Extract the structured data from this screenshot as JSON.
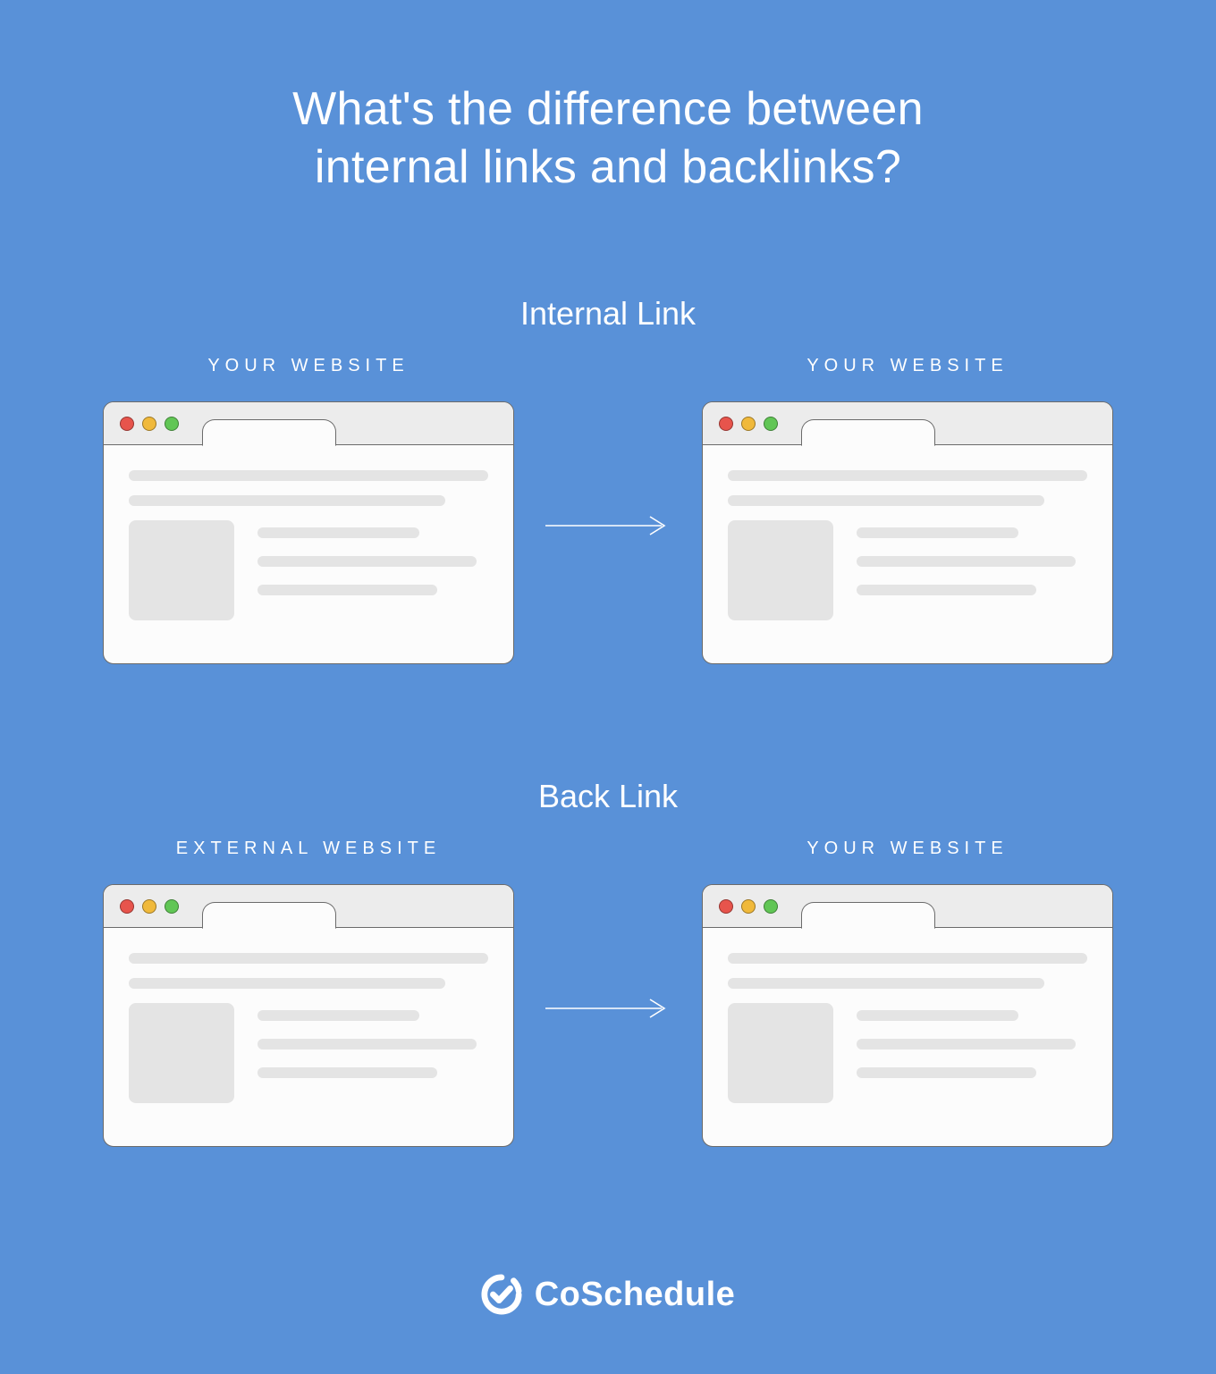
{
  "title_line1": "What's the difference between",
  "title_line2": "internal links and backlinks?",
  "sections": {
    "internal": {
      "heading": "Internal Link",
      "left_label": "YOUR WEBSITE",
      "right_label": "YOUR WEBSITE"
    },
    "backlink": {
      "heading": "Back Link",
      "left_label": "EXTERNAL WEBSITE",
      "right_label": "YOUR WEBSITE"
    }
  },
  "brand": "CoSchedule"
}
